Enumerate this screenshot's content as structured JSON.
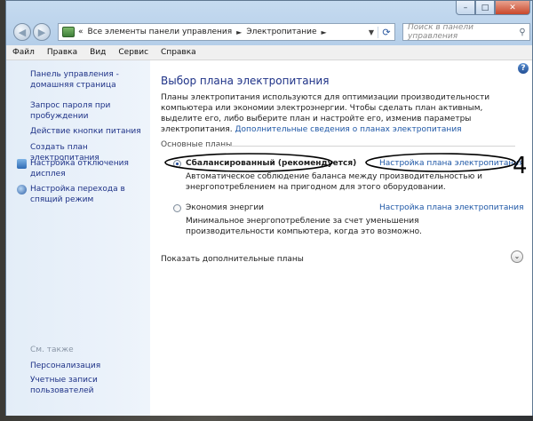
{
  "window": {
    "caption_buttons": {
      "minimize": "–",
      "maximize": "□",
      "close": "✕"
    }
  },
  "address": {
    "chevron": "«",
    "breadcrumb": [
      "Все элементы панели управления",
      "Электропитание"
    ],
    "separator": "►"
  },
  "search": {
    "placeholder": "Поиск в панели управления"
  },
  "menu": [
    "Файл",
    "Правка",
    "Вид",
    "Сервис",
    "Справка"
  ],
  "sidebar": {
    "home_link": "Панель управления - домашняя страница",
    "items": [
      "Запрос пароля при пробуждении",
      "Действие кнопки питания",
      "Создать план электропитания",
      "Настройка отключения дисплея",
      "Настройка перехода в спящий режим"
    ],
    "see_also_label": "См. также",
    "see_also": [
      "Персонализация",
      "Учетные записи пользователей"
    ]
  },
  "main": {
    "help_glyph": "?",
    "title": "Выбор плана электропитания",
    "description": "Планы электропитания используются для оптимизации производительности компьютера или экономии электроэнергии. Чтобы сделать план активным, выделите его, либо выберите план и настройте его, изменив параметры электропитания.",
    "more_link": "Дополнительные сведения о планах электропитания",
    "group_label": "Основные планы",
    "plans": [
      {
        "name": "Сбалансированный (рекомендуется)",
        "selected": true,
        "description": "Автоматическое соблюдение баланса между производительностью и энергопотреблением на пригодном для этого оборудовании.",
        "settings_link": "Настройка плана электропитания"
      },
      {
        "name": "Экономия энергии",
        "selected": false,
        "description": "Минимальное энергопотребление за счет уменьшения производительности компьютера, когда это возможно.",
        "settings_link": "Настройка плана электропитания"
      }
    ],
    "show_more": "Показать дополнительные планы",
    "expand_glyph": "⌄"
  },
  "annotation": {
    "number": "4"
  },
  "colors": {
    "link": "#1e57a6",
    "sidebar_link": "#1e3287",
    "ink": "#000000"
  }
}
